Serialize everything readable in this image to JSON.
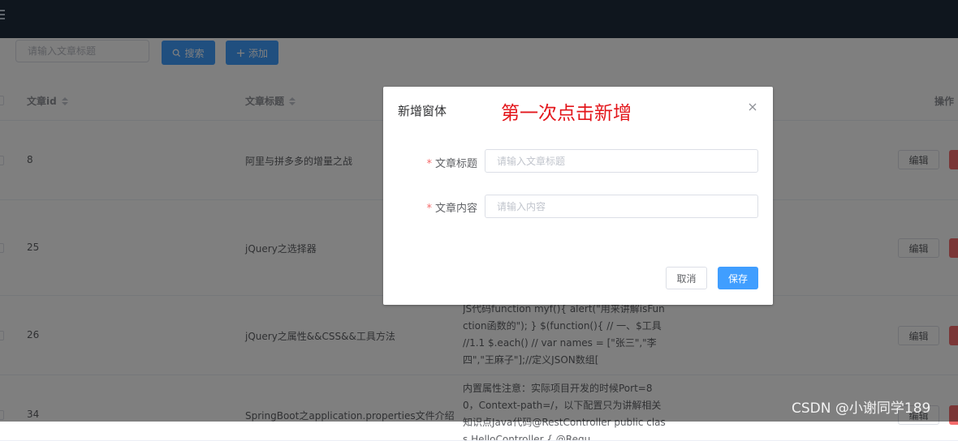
{
  "toolbar": {
    "search_placeholder": "请输入文章标题",
    "search_label": "搜索",
    "add_label": "添加"
  },
  "table": {
    "columns": [
      "文章id",
      "文章标题",
      "操作"
    ],
    "rows": [
      {
        "id": "8",
        "title": "阿里与拼多多的增量之战",
        "content": "",
        "edit": "编辑"
      },
      {
        "id": "25",
        "title": "jQuery之选择器",
        "content": "",
        "edit": "编辑"
      },
      {
        "id": "26",
        "title": "jQuery之属性&&CSS&&工具方法",
        "content": "JS代码function myf(){ alert(\"用来讲解isFunction函数的\"); } $(function(){ // 一、$工具 //1.1 $.each() // var names = [\"张三\",\"李四\",\"王麻子\"];//定义JSON数组[",
        "edit": "编辑"
      },
      {
        "id": "34",
        "title": "SpringBoot之application.properties文件介绍",
        "content": "内置属性注意：实际项目开发的时候Port=80，Context-path=/，以下配置只为讲解相关知识点Java代码@RestController public class HelloController { @Requ",
        "edit": "编辑"
      }
    ]
  },
  "dialog": {
    "title": "新增窗体",
    "annotation": "第一次点击新增",
    "fields": [
      {
        "label": "文章标题",
        "placeholder": "请输入文章标题"
      },
      {
        "label": "文章内容",
        "placeholder": "请输入内容"
      }
    ],
    "cancel_label": "取消",
    "save_label": "保存"
  },
  "watermark": "CSDN @小谢同学189",
  "colors": {
    "topbar": "#1f2d3d",
    "primary": "#409eff",
    "danger": "#f56c6c",
    "annotation": "#e3161b"
  }
}
